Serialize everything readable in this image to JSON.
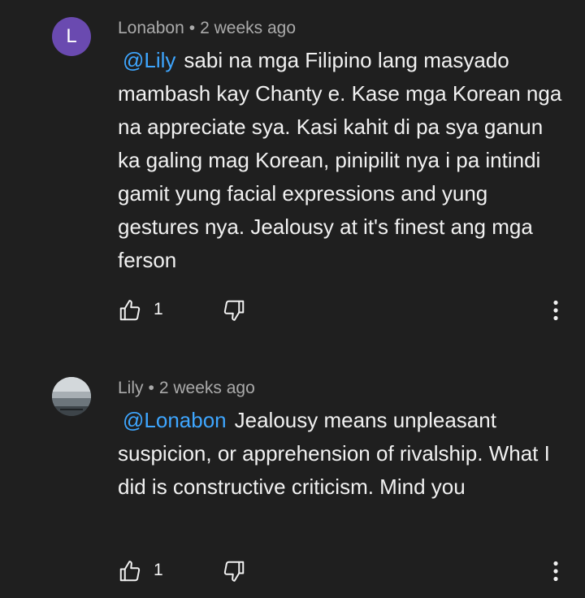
{
  "comments": [
    {
      "author": "Lonabon",
      "avatar_letter": "L",
      "avatar_color": "#6a4ab0",
      "separator": "•",
      "time": "2 weeks ago",
      "mention": "@Lily",
      "text": "sabi na mga Filipino lang masyado mambash kay Chanty e. Kase mga Korean nga na appreciate sya. Kasi kahit di pa sya ganun ka galing mag Korean, pinipilit nya i pa intindi gamit yung facial expressions and yung gestures nya. Jealousy at it's finest ang mga ferson",
      "likes": "1",
      "icons": {
        "like": "thumb-up-icon",
        "dislike": "thumb-down-icon",
        "more": "more-vertical-icon"
      }
    },
    {
      "author": "Lily",
      "separator": "•",
      "time": "2 weeks ago",
      "mention": "@Lonabon",
      "text": "Jealousy means unpleasant suspicion, or apprehension of rivalship. What I did is constructive criticism. Mind you",
      "likes": "1",
      "icons": {
        "like": "thumb-up-icon",
        "dislike": "thumb-down-icon",
        "more": "more-vertical-icon"
      }
    }
  ],
  "colors": {
    "background": "#1f1f1f",
    "text": "#f1f1f1",
    "meta": "#aaaaaa",
    "mention": "#3ea6ff"
  }
}
